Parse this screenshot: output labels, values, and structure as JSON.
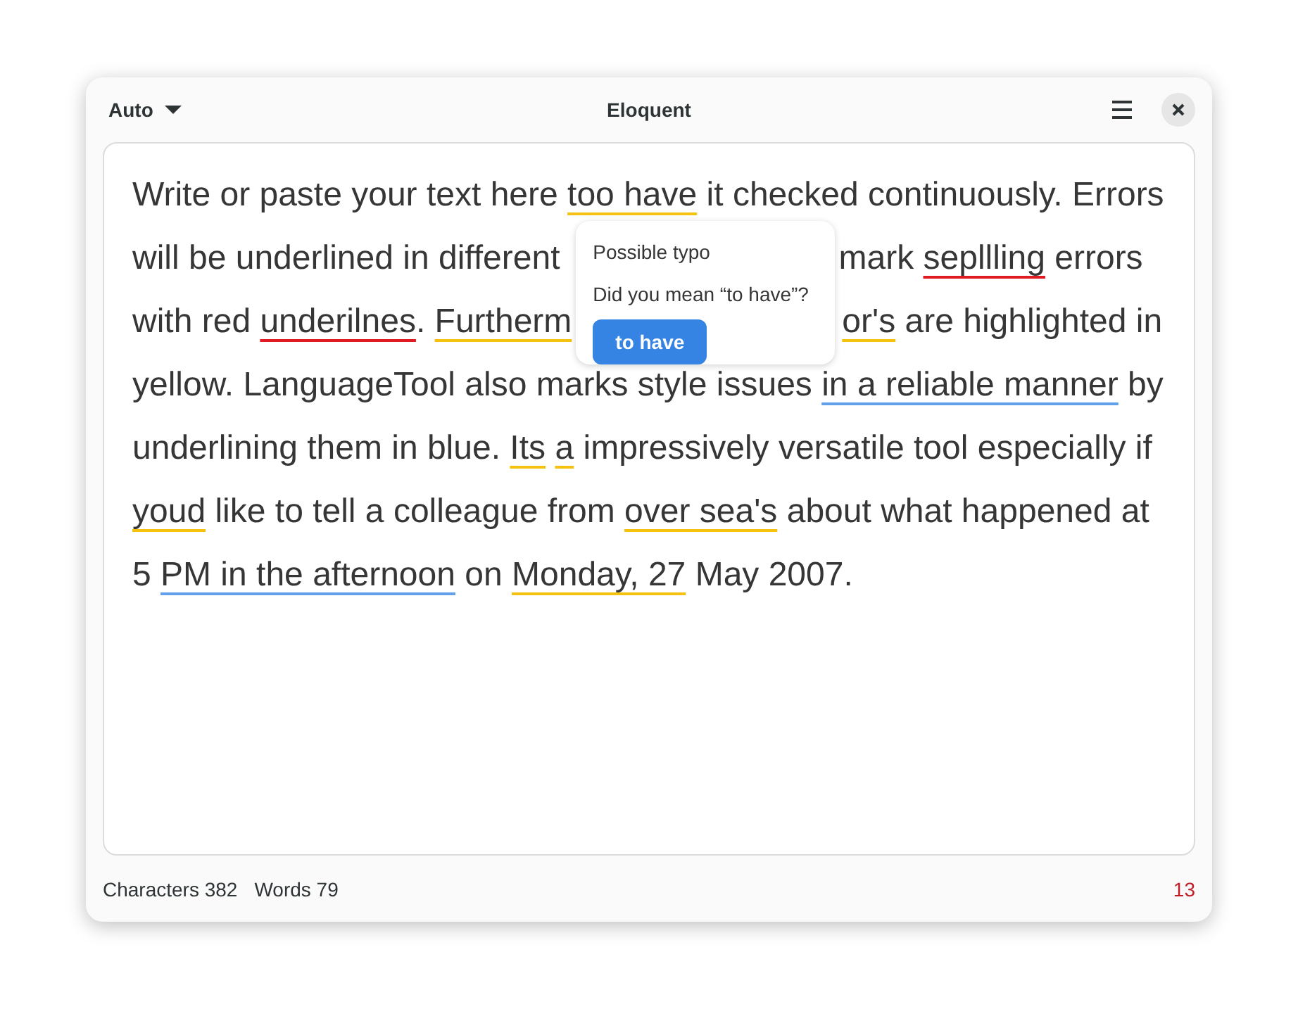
{
  "window": {
    "title": "Eloquent",
    "language_menu": {
      "label": "Auto"
    }
  },
  "editor": {
    "lines": [
      {
        "segments": [
          {
            "text": "Write or paste your text here "
          },
          {
            "text": "too have",
            "color": "#f5c211"
          },
          {
            "text": " it checked continuously. Errors"
          }
        ]
      },
      {
        "segments": [
          {
            "text": "will be underlined in different"
          },
          {
            "kind": "gap"
          },
          {
            "text": "mark "
          },
          {
            "text": "sepllling",
            "color": "#e01b24"
          },
          {
            "text": " errors"
          }
        ]
      },
      {
        "segments": [
          {
            "text": "with red "
          },
          {
            "text": "underilnes",
            "color": "#e01b24"
          },
          {
            "text": ". "
          },
          {
            "text": "Furtherm",
            "color": "#f5c211"
          },
          {
            "kind": "gap"
          },
          {
            "text": "or's",
            "color": "#f5c211"
          },
          {
            "text": " are highlighted in"
          }
        ]
      },
      {
        "segments": [
          {
            "text": "yellow. LanguageTool also marks style issues "
          },
          {
            "text": "in a reliable manner",
            "color": "#62a0ea"
          },
          {
            "text": " by"
          }
        ]
      },
      {
        "segments": [
          {
            "text": "underlining them in blue. "
          },
          {
            "text": "Its",
            "color": "#f5c211"
          },
          {
            "text": "a",
            "color": "#f5c211",
            "space_before": true
          },
          {
            "text": " impressively versatile tool especially if"
          }
        ]
      },
      {
        "segments": [
          {
            "text": "youd",
            "color": "#f5c211"
          },
          {
            "text": " like to tell a colleague from "
          },
          {
            "text": "over sea's",
            "color": "#f5c211"
          },
          {
            "text": " about what happened at"
          }
        ]
      },
      {
        "segments": [
          {
            "text": "5 "
          },
          {
            "text": "PM in the afternoon",
            "color": "#62a0ea"
          },
          {
            "text": " on "
          },
          {
            "text": "Monday, 27",
            "color": "#f5c211"
          },
          {
            "text": " May 2007."
          }
        ]
      }
    ]
  },
  "popover": {
    "title": "Possible typo",
    "message": "Did you mean “to have”?",
    "suggestion": "to have"
  },
  "status_bar": {
    "characters": "Characters 382",
    "words": "Words 79",
    "issues": "13"
  }
}
